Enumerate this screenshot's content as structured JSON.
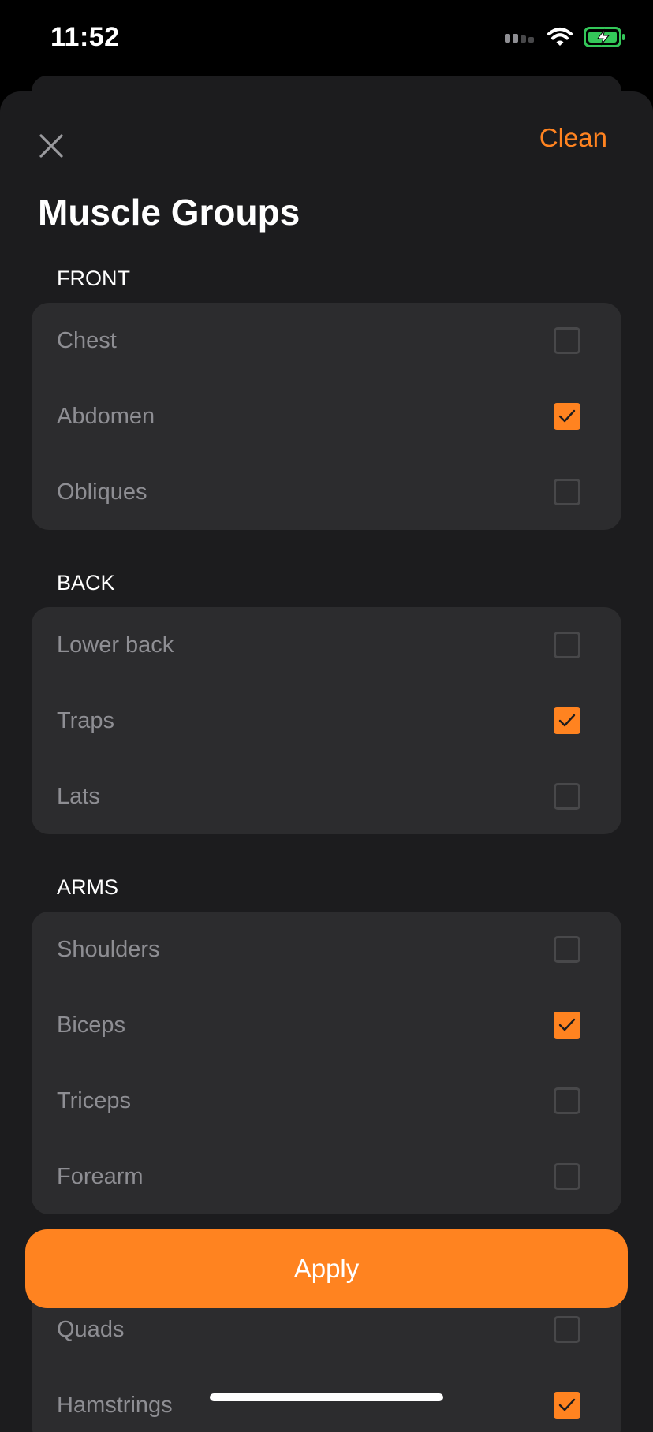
{
  "status_bar": {
    "time": "11:52"
  },
  "header": {
    "clean_label": "Clean",
    "title": "Muscle Groups"
  },
  "sections": [
    {
      "label": "FRONT",
      "items": [
        {
          "label": "Chest",
          "checked": false
        },
        {
          "label": "Abdomen",
          "checked": true
        },
        {
          "label": "Obliques",
          "checked": false
        }
      ]
    },
    {
      "label": "BACK",
      "items": [
        {
          "label": "Lower back",
          "checked": false
        },
        {
          "label": "Traps",
          "checked": true
        },
        {
          "label": "Lats",
          "checked": false
        }
      ]
    },
    {
      "label": "ARMS",
      "items": [
        {
          "label": "Shoulders",
          "checked": false
        },
        {
          "label": "Biceps",
          "checked": true
        },
        {
          "label": "Triceps",
          "checked": false
        },
        {
          "label": "Forearm",
          "checked": false
        }
      ]
    },
    {
      "label": "",
      "items": [
        {
          "label": "Quads",
          "checked": false
        },
        {
          "label": "Hamstrings",
          "checked": true
        }
      ]
    }
  ],
  "apply_label": "Apply",
  "colors": {
    "accent": "#ff8320",
    "sheet_bg": "#1c1c1e",
    "card_bg": "#2c2c2e",
    "item_text": "#8e8e93",
    "battery": "#34c759"
  },
  "icons": {
    "close": "close-icon",
    "check": "checkmark-icon",
    "signal": "cellular-signal-icon",
    "wifi": "wifi-icon",
    "battery": "battery-charging-icon"
  }
}
